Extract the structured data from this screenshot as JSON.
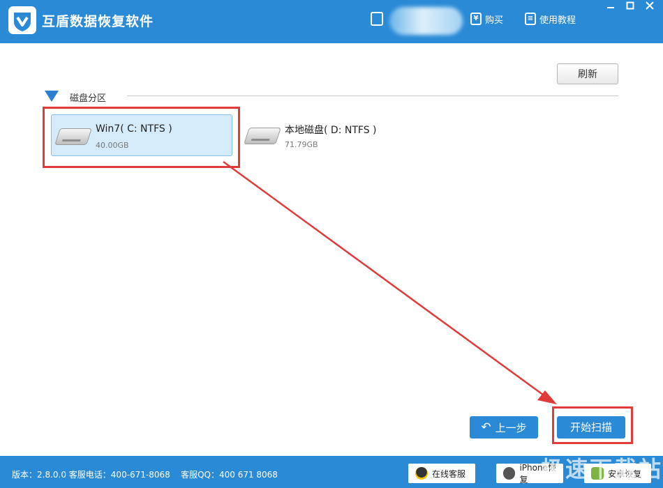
{
  "app": {
    "title": "互盾数据恢复软件"
  },
  "header": {
    "buy_label": "购买",
    "tutorial_label": "使用教程"
  },
  "toolbar": {
    "refresh_label": "刷新"
  },
  "section": {
    "label": "磁盘分区"
  },
  "disks": [
    {
      "name": "Win7( C: NTFS )",
      "size": "40.00GB",
      "selected": true
    },
    {
      "name": "本地磁盘( D: NTFS )",
      "size": "71.79GB",
      "selected": false
    }
  ],
  "actions": {
    "back_label": "上一步",
    "scan_label": "开始扫描"
  },
  "footer": {
    "version_text": "版本：2.8.0.0 客服电话：400-671-8068",
    "qq_text": "客服QQ：400 671 8068",
    "online_service_label": "在线客服",
    "iphone_label": "iPhone恢复",
    "android_label": "安卓恢复"
  },
  "watermark": "极速下载站",
  "colors": {
    "brand": "#2a8ad6",
    "annotation": "#e03a3a",
    "selected_bg": "#d5ebfa"
  }
}
